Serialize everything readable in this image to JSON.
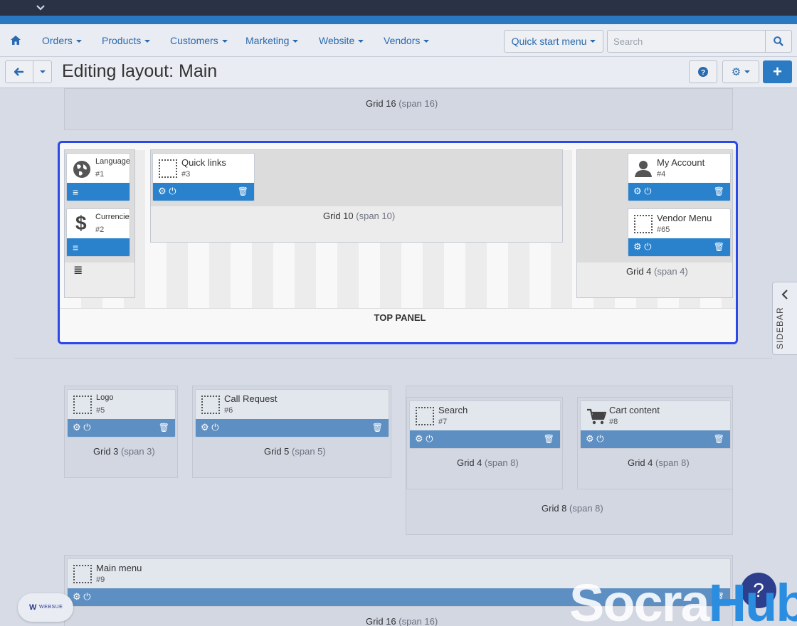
{
  "nav": {
    "home_icon": "home-icon",
    "items": [
      "Orders",
      "Products",
      "Customers",
      "Marketing",
      "Website",
      "Vendors"
    ],
    "quick_start": "Quick start menu",
    "search_placeholder": "Search"
  },
  "page": {
    "title": "Editing layout: Main"
  },
  "grids": {
    "g16_top": {
      "name": "Grid 16",
      "span": "(span 16)"
    },
    "g10": {
      "name": "Grid 10",
      "span": "(span 10)"
    },
    "g4_right": {
      "name": "Grid 4",
      "span": "(span 4)"
    },
    "g3": {
      "name": "Grid 3",
      "span": "(span 3)"
    },
    "g5": {
      "name": "Grid 5",
      "span": "(span 5)"
    },
    "g4a": {
      "name": "Grid 4",
      "span": "(span 8)"
    },
    "g4b": {
      "name": "Grid 4",
      "span": "(span 8)"
    },
    "g8": {
      "name": "Grid 8",
      "span": "(span 8)"
    },
    "g16_bottom": {
      "name": "Grid 16",
      "span": "(span 16)"
    }
  },
  "blocks": {
    "languages": {
      "name": "Languages",
      "id": "#1",
      "icon": "globe-icon"
    },
    "currencies": {
      "name": "Currencies",
      "id": "#2",
      "icon": "dollar-icon"
    },
    "quick_links": {
      "name": "Quick links",
      "id": "#3"
    },
    "my_account": {
      "name": "My Account",
      "id": "#4",
      "icon": "user-icon"
    },
    "vendor_menu": {
      "name": "Vendor Menu",
      "id": "#65"
    },
    "logo": {
      "name": "Logo",
      "id": "#5"
    },
    "call_request": {
      "name": "Call Request",
      "id": "#6"
    },
    "search": {
      "name": "Search",
      "id": "#7"
    },
    "cart_content": {
      "name": "Cart content",
      "id": "#8",
      "icon": "cart-icon"
    },
    "main_menu": {
      "name": "Main menu",
      "id": "#9"
    }
  },
  "top_panel_label": "TOP PANEL",
  "sidebar_label": "SIDEBAR",
  "watermark": {
    "part1": "Socra",
    "part2": "Hub"
  },
  "badge": "WEBSUE",
  "colors": {
    "accent": "#2a82cc",
    "highlight_border": "#2b48e8",
    "topbar": "#2a3246"
  }
}
